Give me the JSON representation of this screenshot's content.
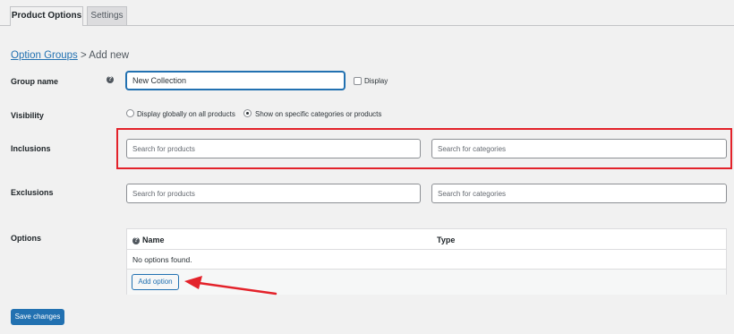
{
  "tabs": [
    {
      "label": "Product Options",
      "active": true
    },
    {
      "label": "Settings",
      "active": false
    }
  ],
  "breadcrumb": {
    "link": "Option Groups",
    "separator": ">",
    "current": "Add new"
  },
  "form": {
    "group_name": {
      "label": "Group name",
      "value": "New Collection",
      "display_label": "Display",
      "display_checked": false
    },
    "visibility": {
      "label": "Visibility",
      "options": [
        {
          "label": "Display globally on all products",
          "selected": false
        },
        {
          "label": "Show on specific categories or products",
          "selected": true
        }
      ]
    },
    "inclusions": {
      "label": "Inclusions",
      "products_placeholder": "Search for products",
      "categories_placeholder": "Search for categories"
    },
    "exclusions": {
      "label": "Exclusions",
      "products_placeholder": "Search for products",
      "categories_placeholder": "Search for categories"
    },
    "options": {
      "label": "Options",
      "columns": [
        "Name",
        "Type"
      ],
      "empty_text": "No options found.",
      "add_button": "Add option"
    }
  },
  "save_button": "Save changes",
  "colors": {
    "accent": "#2271b1",
    "highlight": "#e3222a",
    "arrow": "#e3222a"
  },
  "icons": {
    "help": "help-icon",
    "arrow": "red-arrow-annotation"
  }
}
